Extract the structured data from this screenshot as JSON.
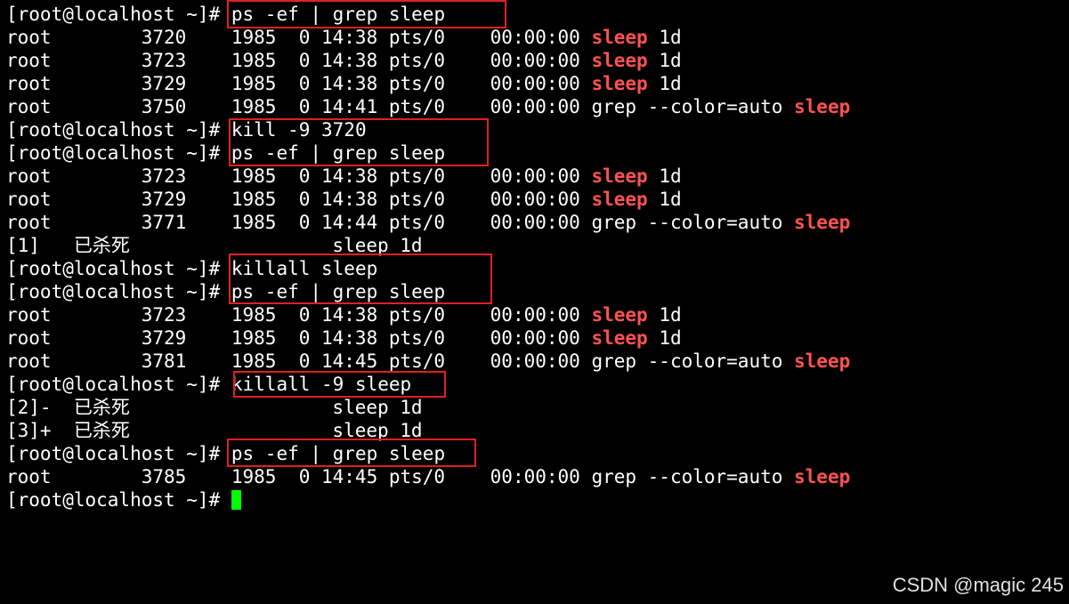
{
  "terminal": {
    "lines": [
      {
        "prompt": "[root@localhost ~]# ",
        "command": "ps -ef | grep sleep"
      },
      {
        "text": "root        3720    1985  0 14:38 pts/0    00:00:00 ",
        "hl": "sleep",
        "tail": " 1d"
      },
      {
        "text": "root        3723    1985  0 14:38 pts/0    00:00:00 ",
        "hl": "sleep",
        "tail": " 1d"
      },
      {
        "text": "root        3729    1985  0 14:38 pts/0    00:00:00 ",
        "hl": "sleep",
        "tail": " 1d"
      },
      {
        "text": "root        3750    1985  0 14:41 pts/0    00:00:00 grep --color=auto ",
        "hl": "sleep",
        "tail": ""
      },
      {
        "prompt": "[root@localhost ~]# ",
        "command": "kill -9 3720"
      },
      {
        "prompt": "[root@localhost ~]# ",
        "command": "ps -ef | grep sleep"
      },
      {
        "text": "root        3723    1985  0 14:38 pts/0    00:00:00 ",
        "hl": "sleep",
        "tail": " 1d"
      },
      {
        "text": "root        3729    1985  0 14:38 pts/0    00:00:00 ",
        "hl": "sleep",
        "tail": " 1d"
      },
      {
        "text": "root        3771    1985  0 14:44 pts/0    00:00:00 grep --color=auto ",
        "hl": "sleep",
        "tail": ""
      },
      {
        "text": "[1]   已杀死                  sleep 1d"
      },
      {
        "prompt": "[root@localhost ~]# ",
        "command": "killall sleep"
      },
      {
        "prompt": "[root@localhost ~]# ",
        "command": "ps -ef | grep sleep"
      },
      {
        "text": "root        3723    1985  0 14:38 pts/0    00:00:00 ",
        "hl": "sleep",
        "tail": " 1d"
      },
      {
        "text": "root        3729    1985  0 14:38 pts/0    00:00:00 ",
        "hl": "sleep",
        "tail": " 1d"
      },
      {
        "text": "root        3781    1985  0 14:45 pts/0    00:00:00 grep --color=auto ",
        "hl": "sleep",
        "tail": ""
      },
      {
        "prompt": "[root@localhost ~]# ",
        "command": "killall -9 sleep"
      },
      {
        "text": "[2]-  已杀死                  sleep 1d"
      },
      {
        "text": "[3]+  已杀死                  sleep 1d"
      },
      {
        "prompt": "[root@localhost ~]# ",
        "command": "ps -ef | grep sleep"
      },
      {
        "text": "root        3785    1985  0 14:45 pts/0    00:00:00 grep --color=auto ",
        "hl": "sleep",
        "tail": ""
      },
      {
        "prompt": "[root@localhost ~]# ",
        "command": "",
        "cursor": true
      }
    ]
  },
  "watermark": "CSDN @magic 245",
  "colors": {
    "background": "#000000",
    "foreground": "#ffffff",
    "highlight": "#ff5252",
    "annotation_box": "#e02020",
    "cursor": "#00ff00"
  }
}
